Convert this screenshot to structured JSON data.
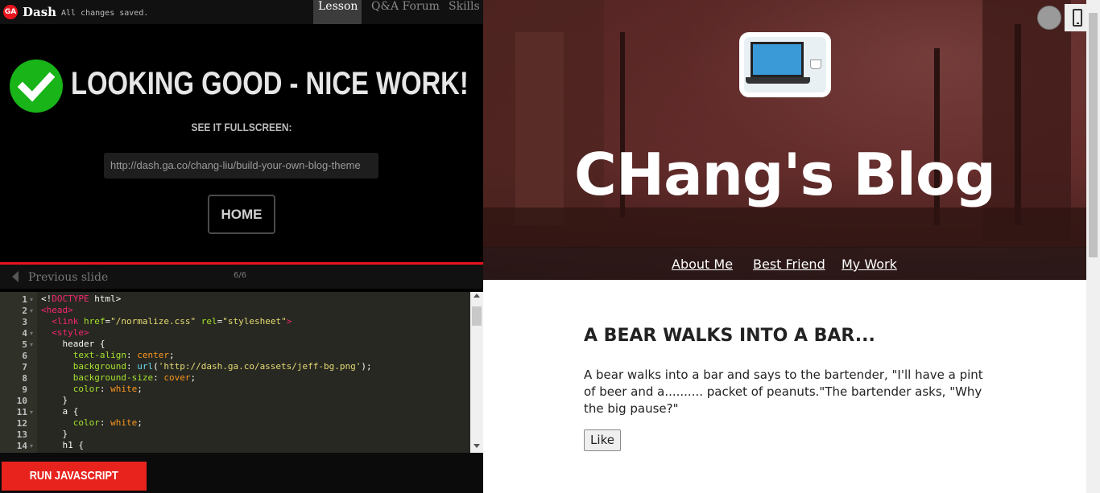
{
  "topbar": {
    "logo_text": "GA",
    "app_name": "Dash",
    "save_status": "All changes saved.",
    "tabs": [
      {
        "label": "Lesson"
      },
      {
        "label": "Q&A Forum"
      },
      {
        "label": "Skills"
      }
    ]
  },
  "success": {
    "headline": "LOOKING GOOD - NICE WORK!",
    "fullscreen_label": "SEE IT FULLSCREEN:",
    "fullscreen_url": "http://dash.ga.co/chang-liu/build-your-own-blog-theme",
    "home_label": "HOME"
  },
  "slide_nav": {
    "prev_label": "Previous slide",
    "counter": "6/6"
  },
  "editor": {
    "line_numbers": [
      "1",
      "2",
      "3",
      "4",
      "5",
      "6",
      "7",
      "8",
      "9",
      "10",
      "11",
      "12",
      "13",
      "14"
    ]
  },
  "run_button_label": "RUN JAVASCRIPT",
  "blog": {
    "title": "CHang's Blog",
    "nav": [
      {
        "label": "About Me"
      },
      {
        "label": "Best Friend"
      },
      {
        "label": "My Work"
      }
    ],
    "post_title": "A BEAR WALKS INTO A BAR...",
    "post_body": "A bear walks into a bar and says to the bartender, \"I'll have a pint of beer and a.......... packet of peanuts.\"The bartender asks, \"Why the big pause?\"",
    "like_label": "Like"
  },
  "colors": {
    "accent_red": "#e8141e",
    "success_green": "#18b418",
    "editor_bg": "#272822"
  }
}
